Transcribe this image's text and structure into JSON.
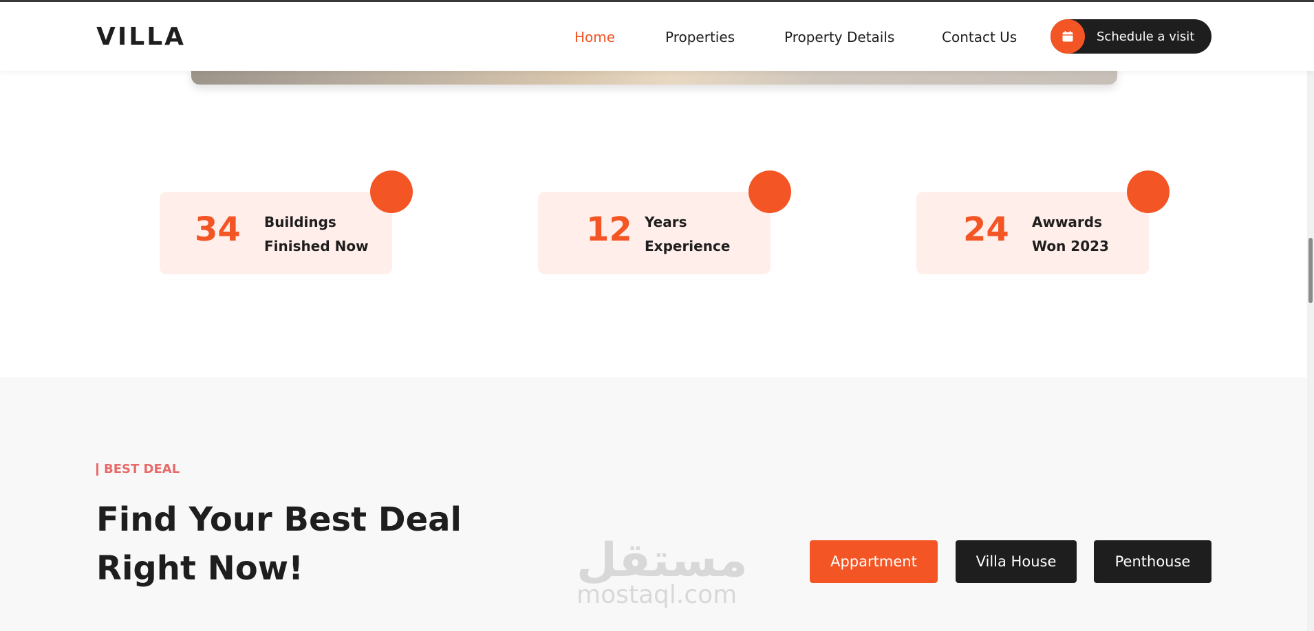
{
  "header": {
    "logo": "VILLA",
    "nav": [
      {
        "label": "Home",
        "active": true
      },
      {
        "label": "Properties",
        "active": false
      },
      {
        "label": "Property Details",
        "active": false
      },
      {
        "label": "Contact Us",
        "active": false
      }
    ],
    "schedule_label": "Schedule a visit",
    "schedule_icon": "calendar-icon"
  },
  "stats": [
    {
      "number": "34",
      "line1": "Buildings",
      "line2": "Finished Now"
    },
    {
      "number": "12",
      "line1": "Years",
      "line2": "Experience"
    },
    {
      "number": "24",
      "line1": "Awwards",
      "line2": "Won 2023"
    }
  ],
  "deal": {
    "tag": "BEST DEAL",
    "title_line1": "Find Your Best Deal",
    "title_line2": "Right Now!",
    "tabs": [
      "Appartment",
      "Villa House",
      "Penthouse"
    ]
  },
  "watermark": {
    "arabic": "مستقل",
    "latin": "mostaql.com"
  },
  "colors": {
    "accent": "#f35525",
    "dark": "#1e1e1e",
    "card_bg": "#ffeeea",
    "section_bg": "#f8f8f8",
    "tag": "#e86a6a"
  }
}
